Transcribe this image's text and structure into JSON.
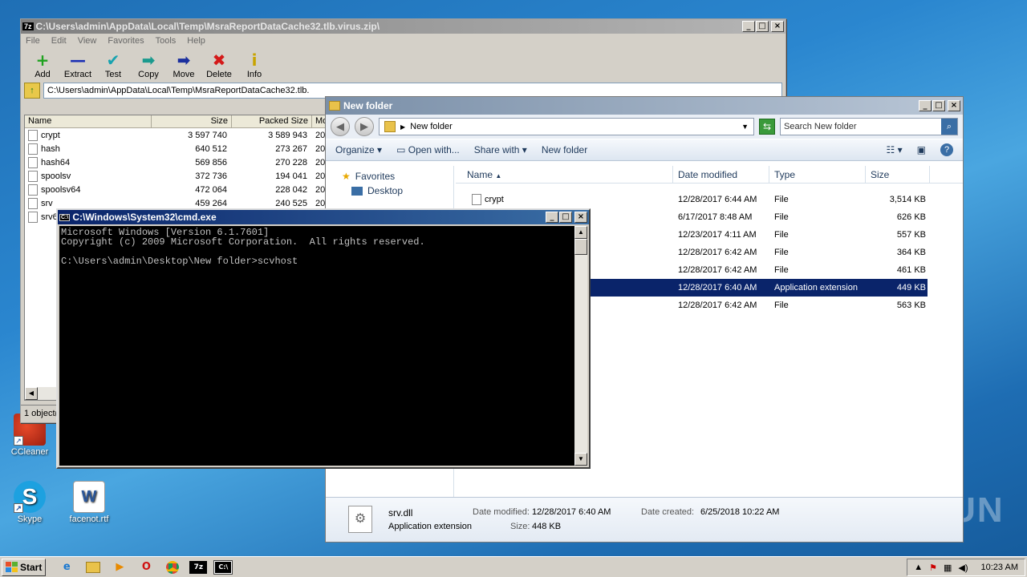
{
  "desktop": {
    "icons": [
      {
        "label": "CCleaner"
      },
      {
        "label": "Skype"
      },
      {
        "label": "facenot.rtf"
      }
    ],
    "watermark": "ANY RUN"
  },
  "sevenzip": {
    "title": "C:\\Users\\admin\\AppData\\Local\\Temp\\MsraReportDataCache32.tlb.virus.zip\\",
    "menu": [
      "File",
      "Edit",
      "View",
      "Favorites",
      "Tools",
      "Help"
    ],
    "toolbar": [
      {
        "label": "Add",
        "icon": "+",
        "color": "#1fa21f"
      },
      {
        "label": "Extract",
        "icon": "—",
        "color": "#1b2fb5"
      },
      {
        "label": "Test",
        "icon": "✔",
        "color": "#19a3b0"
      },
      {
        "label": "Copy",
        "icon": "➡",
        "color": "#1b9a8e"
      },
      {
        "label": "Move",
        "icon": "➡",
        "color": "#1b2f9e"
      },
      {
        "label": "Delete",
        "icon": "✖",
        "color": "#d41a1a"
      },
      {
        "label": "Info",
        "icon": "i",
        "color": "#c8a400"
      }
    ],
    "address": "C:\\Users\\admin\\AppData\\Local\\Temp\\MsraReportDataCache32.tlb.",
    "columns": [
      "Name",
      "Size",
      "Packed Size",
      "Mo"
    ],
    "files": [
      {
        "name": "crypt",
        "size": "3 597 740",
        "packed": "3 589 943",
        "mod": "20"
      },
      {
        "name": "hash",
        "size": "640 512",
        "packed": "273 267",
        "mod": "20"
      },
      {
        "name": "hash64",
        "size": "569 856",
        "packed": "270 228",
        "mod": "20"
      },
      {
        "name": "spoolsv",
        "size": "372 736",
        "packed": "194 041",
        "mod": "20"
      },
      {
        "name": "spoolsv64",
        "size": "472 064",
        "packed": "228 042",
        "mod": "20"
      },
      {
        "name": "srv",
        "size": "459 264",
        "packed": "240 525",
        "mod": "20"
      },
      {
        "name": "srv6",
        "size": "",
        "packed": "",
        "mod": ""
      }
    ],
    "status": "1 object("
  },
  "explorer": {
    "title": "New folder",
    "breadcrumb": "New folder",
    "search_placeholder": "Search New folder",
    "commands": [
      "Organize",
      "Open with...",
      "Share with",
      "New folder"
    ],
    "nav": {
      "favorites": "Favorites",
      "desktop": "Desktop"
    },
    "columns": [
      "Name",
      "Date modified",
      "Type",
      "Size"
    ],
    "rows": [
      {
        "name": "crypt",
        "date": "12/28/2017 6:44 AM",
        "type": "File",
        "size": "3,514 KB"
      },
      {
        "name": "",
        "date": "6/17/2017 8:48 AM",
        "type": "File",
        "size": "626 KB"
      },
      {
        "name": "",
        "date": "12/23/2017 4:11 AM",
        "type": "File",
        "size": "557 KB"
      },
      {
        "name": "",
        "date": "12/28/2017 6:42 AM",
        "type": "File",
        "size": "364 KB"
      },
      {
        "name": "",
        "date": "12/28/2017 6:42 AM",
        "type": "File",
        "size": "461 KB"
      },
      {
        "name": "",
        "date": "12/28/2017 6:40 AM",
        "type": "Application extension",
        "size": "449 KB"
      },
      {
        "name": "",
        "date": "12/28/2017 6:42 AM",
        "type": "File",
        "size": "563 KB"
      }
    ],
    "details": {
      "filename": "srv.dll",
      "type": "Application extension",
      "modified_label": "Date modified:",
      "modified": "12/28/2017 6:40 AM",
      "size_label": "Size:",
      "size": "448 KB",
      "created_label": "Date created:",
      "created": "6/25/2018 10:22 AM"
    }
  },
  "cmd": {
    "title": "C:\\Windows\\System32\\cmd.exe",
    "output": "Microsoft Windows [Version 6.1.7601]\nCopyright (c) 2009 Microsoft Corporation.  All rights reserved.\n\nC:\\Users\\admin\\Desktop\\New folder>scvhost"
  },
  "taskbar": {
    "start": "Start",
    "clock": "10:23 AM"
  }
}
